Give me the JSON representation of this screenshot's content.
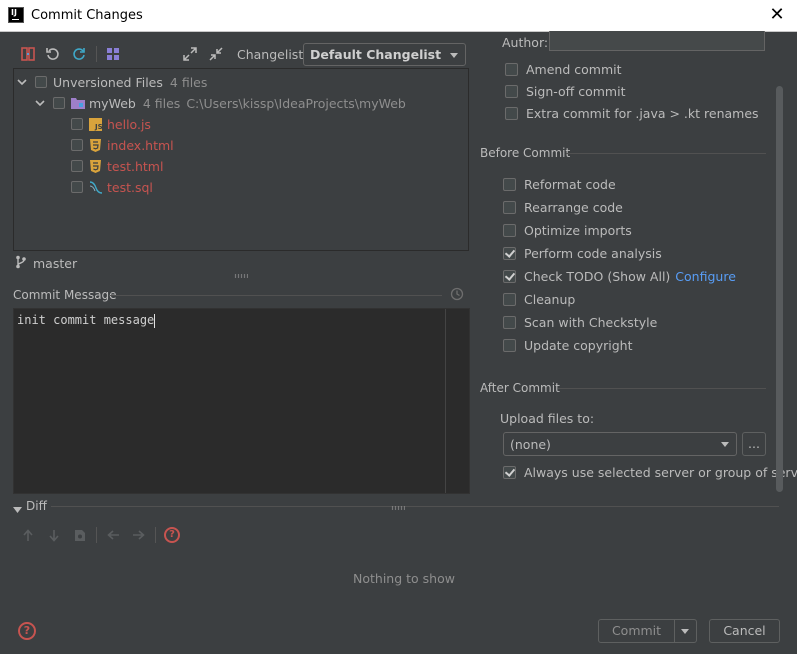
{
  "window": {
    "title": "Commit Changes",
    "close_glyph": "✕"
  },
  "toolbar": {
    "icons": [
      "diff-icon",
      "rollback-icon",
      "refresh-icon",
      "group-by-icon",
      "expand-all-icon",
      "collapse-all-icon"
    ],
    "changelist_label": "Changelist:",
    "changelist_value": "Default Changelist"
  },
  "tree": {
    "root": {
      "label": "Unversioned Files",
      "count": "4 files"
    },
    "module": {
      "label": "myWeb",
      "count": "4 files",
      "path": "C:\\Users\\kissp\\IdeaProjects\\myWeb"
    },
    "files": [
      {
        "name": "hello.js",
        "icon": "js-file-icon",
        "color": "#c75450"
      },
      {
        "name": "index.html",
        "icon": "html-file-icon",
        "color": "#c75450"
      },
      {
        "name": "test.html",
        "icon": "html-file-icon",
        "color": "#c75450"
      },
      {
        "name": "test.sql",
        "icon": "sql-file-icon",
        "color": "#c75450"
      }
    ]
  },
  "branch": {
    "name": "master",
    "icon": "branch-icon"
  },
  "commit_message": {
    "label": "Commit Message",
    "value": "init commit message",
    "history_icon": "history-icon"
  },
  "author": {
    "label": "Author:",
    "value": ""
  },
  "options": {
    "amend": "Amend commit",
    "signoff": "Sign-off commit",
    "extra": "Extra commit for .java > .kt renames"
  },
  "before_commit": {
    "title": "Before Commit",
    "items": [
      {
        "label": "Reformat code",
        "checked": false
      },
      {
        "label": "Rearrange code",
        "checked": false
      },
      {
        "label": "Optimize imports",
        "checked": false
      },
      {
        "label": "Perform code analysis",
        "checked": true
      },
      {
        "label": "Check TODO (Show All)",
        "checked": true,
        "link": "Configure"
      },
      {
        "label": "Cleanup",
        "checked": false
      },
      {
        "label": "Scan with Checkstyle",
        "checked": false
      },
      {
        "label": "Update copyright",
        "checked": false
      }
    ]
  },
  "after_commit": {
    "title": "After Commit",
    "upload_label": "Upload files to:",
    "upload_value": "(none)",
    "browse_label": "...",
    "always_use_label": "Always use selected server or group of servers",
    "always_use_checked": true
  },
  "diff": {
    "title": "Diff",
    "empty_text": "Nothing to show"
  },
  "footer": {
    "commit_label": "Commit",
    "cancel_label": "Cancel"
  },
  "colors": {
    "background": "#3c3f41",
    "editor": "#2b2b2b",
    "unversioned": "#c75450",
    "link": "#589df6"
  }
}
